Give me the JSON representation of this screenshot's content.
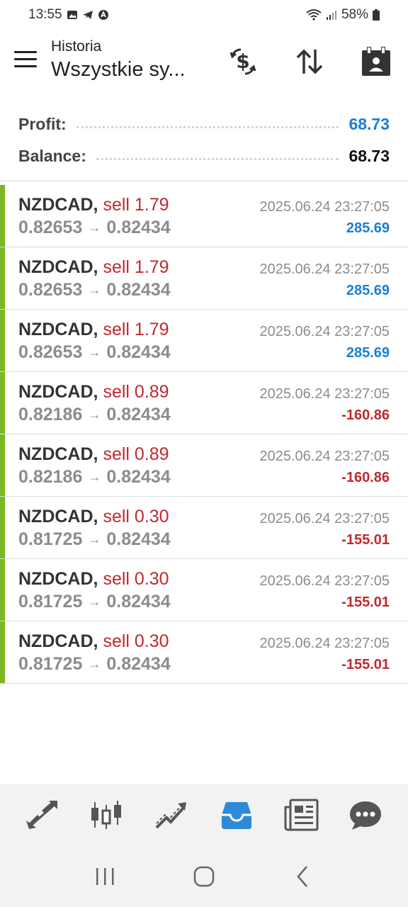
{
  "status_bar": {
    "time": "13:55",
    "battery": "58%"
  },
  "app_bar": {
    "title_small": "Historia",
    "title_big": "Wszystkie sy..."
  },
  "summary": {
    "profit_label": "Profit:",
    "profit_value": "68.73",
    "balance_label": "Balance:",
    "balance_value": "68.73"
  },
  "deals": [
    {
      "symbol": "NZDCAD,",
      "direction": "sell 1.79",
      "open": "0.82653",
      "close": "0.82434",
      "time": "2025.06.24 23:27:05",
      "profit": "285.69",
      "sign": "pos"
    },
    {
      "symbol": "NZDCAD,",
      "direction": "sell 1.79",
      "open": "0.82653",
      "close": "0.82434",
      "time": "2025.06.24 23:27:05",
      "profit": "285.69",
      "sign": "pos"
    },
    {
      "symbol": "NZDCAD,",
      "direction": "sell 1.79",
      "open": "0.82653",
      "close": "0.82434",
      "time": "2025.06.24 23:27:05",
      "profit": "285.69",
      "sign": "pos"
    },
    {
      "symbol": "NZDCAD,",
      "direction": "sell 0.89",
      "open": "0.82186",
      "close": "0.82434",
      "time": "2025.06.24 23:27:05",
      "profit": "-160.86",
      "sign": "neg"
    },
    {
      "symbol": "NZDCAD,",
      "direction": "sell 0.89",
      "open": "0.82186",
      "close": "0.82434",
      "time": "2025.06.24 23:27:05",
      "profit": "-160.86",
      "sign": "neg"
    },
    {
      "symbol": "NZDCAD,",
      "direction": "sell 0.30",
      "open": "0.81725",
      "close": "0.82434",
      "time": "2025.06.24 23:27:05",
      "profit": "-155.01",
      "sign": "neg"
    },
    {
      "symbol": "NZDCAD,",
      "direction": "sell 0.30",
      "open": "0.81725",
      "close": "0.82434",
      "time": "2025.06.24 23:27:05",
      "profit": "-155.01",
      "sign": "neg"
    },
    {
      "symbol": "NZDCAD,",
      "direction": "sell 0.30",
      "open": "0.81725",
      "close": "0.82434",
      "time": "2025.06.24 23:27:05",
      "profit": "-155.01",
      "sign": "neg"
    }
  ],
  "arrow_glyph": "→",
  "colors": {
    "accent": "#1a7fd4",
    "loss": "#c1292e",
    "deal_bar": "#7cb822"
  },
  "tabs": [
    "quotes-icon",
    "chart-icon",
    "trade-icon",
    "history-icon",
    "news-icon",
    "messages-icon"
  ],
  "active_tab": "history-icon"
}
